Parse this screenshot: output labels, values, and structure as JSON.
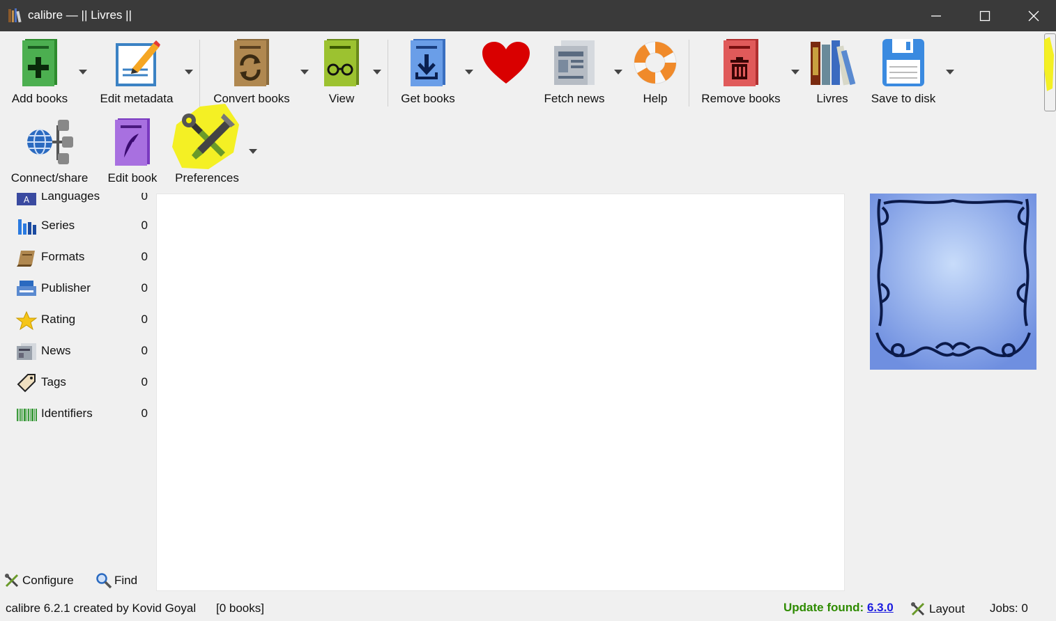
{
  "window": {
    "title": "calibre — || Livres ||"
  },
  "toolbar": {
    "add_books": "Add books",
    "edit_metadata": "Edit metadata",
    "convert_books": "Convert books",
    "view": "View",
    "get_books": "Get books",
    "fetch_news": "Fetch news",
    "help": "Help",
    "remove_books": "Remove books",
    "livres": "Livres",
    "save_to_disk": "Save to disk",
    "connect_share": "Connect/share",
    "edit_book": "Edit book",
    "preferences": "Preferences"
  },
  "tag_browser": {
    "items": [
      {
        "name": "Languages",
        "count": "0",
        "icon": "languages-icon"
      },
      {
        "name": "Series",
        "count": "0",
        "icon": "series-icon"
      },
      {
        "name": "Formats",
        "count": "0",
        "icon": "formats-icon"
      },
      {
        "name": "Publisher",
        "count": "0",
        "icon": "publisher-icon"
      },
      {
        "name": "Rating",
        "count": "0",
        "icon": "star-icon"
      },
      {
        "name": "News",
        "count": "0",
        "icon": "news-icon"
      },
      {
        "name": "Tags",
        "count": "0",
        "icon": "tag-icon"
      },
      {
        "name": "Identifiers",
        "count": "0",
        "icon": "barcode-icon"
      }
    ],
    "configure": "Configure",
    "find": "Find"
  },
  "status": {
    "credits": "calibre 6.2.1 created by Kovid Goyal",
    "book_count": "[0 books]",
    "update_label": "Update found:",
    "update_version": "6.3.0",
    "layout": "Layout",
    "jobs": "Jobs: 0"
  },
  "colors": {
    "titlebar": "#3a3a3a",
    "update_green": "#2e8b00",
    "link_blue": "#1a1adf",
    "highlight_yellow": "#f5f000"
  }
}
